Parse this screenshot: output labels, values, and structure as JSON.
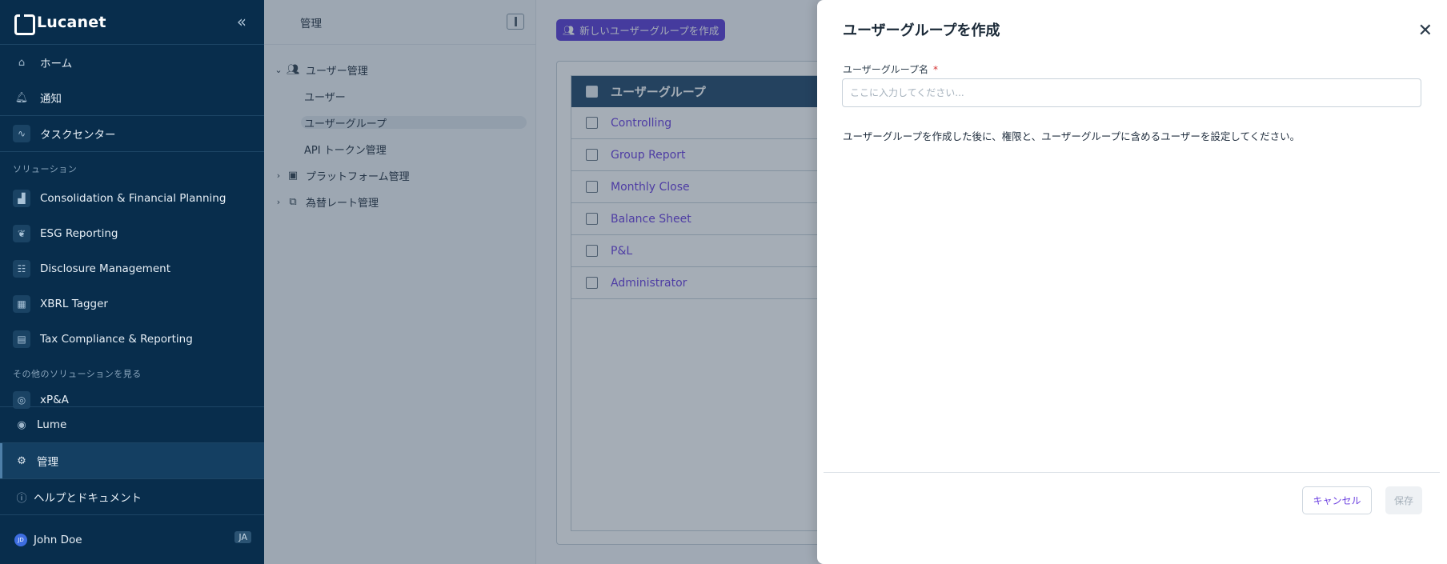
{
  "sidebar": {
    "brand": "Lucanet",
    "collapse_icon": "double-chevron-left-icon",
    "items": [
      {
        "label": "ホーム",
        "icon": "home-icon"
      },
      {
        "label": "通知",
        "icon": "bell-icon"
      },
      {
        "label": "タスクセンター",
        "icon": "activity-icon"
      }
    ],
    "solutions_heading": "ソリューション",
    "solutions": [
      {
        "label": "Consolidation & Financial Planning",
        "icon": "chart-icon"
      },
      {
        "label": "ESG Reporting",
        "icon": "leaf-icon"
      },
      {
        "label": "Disclosure Management",
        "icon": "report-icon"
      },
      {
        "label": "XBRL Tagger",
        "icon": "building-icon"
      },
      {
        "label": "Tax Compliance & Reporting",
        "icon": "tax-icon"
      }
    ],
    "more_heading": "その他のソリューションを見る",
    "more": [
      {
        "label": "xP&A",
        "icon": "compass-icon"
      }
    ],
    "bottom": [
      {
        "label": "Lume",
        "icon": "circle-icon"
      },
      {
        "label": "管理",
        "icon": "gear-icon"
      },
      {
        "label": "ヘルプとドキュメント",
        "icon": "help-icon"
      }
    ],
    "user": {
      "name": "John Doe",
      "initials": "JD",
      "lang": "JA"
    }
  },
  "subnav": {
    "title": "管理",
    "group": "ユーザー管理",
    "children": [
      "ユーザー",
      "ユーザーグループ",
      "API トークン管理"
    ],
    "selected": "ユーザーグループ",
    "others": [
      {
        "label": "プラットフォーム管理",
        "icon": "platform-icon"
      },
      {
        "label": "為替レート管理",
        "icon": "exchange-icon"
      }
    ]
  },
  "main": {
    "create_button": "新しいユーザーグループを作成",
    "table": {
      "header": "ユーザーグループ",
      "rows": [
        "Controlling",
        "Group Report",
        "Monthly Close",
        "Balance Sheet",
        "P&L",
        "Administrator"
      ]
    }
  },
  "dialog": {
    "title": "ユーザーグループを作成",
    "field_label": "ユーザーグループ名",
    "required_mark": "*",
    "placeholder": "ここに入力してください...",
    "value": "",
    "description": "ユーザーグループを作成した後に、権限と、ユーザーグループに含めるユーザーを設定してください。",
    "cancel": "キャンセル",
    "save": "保存"
  }
}
